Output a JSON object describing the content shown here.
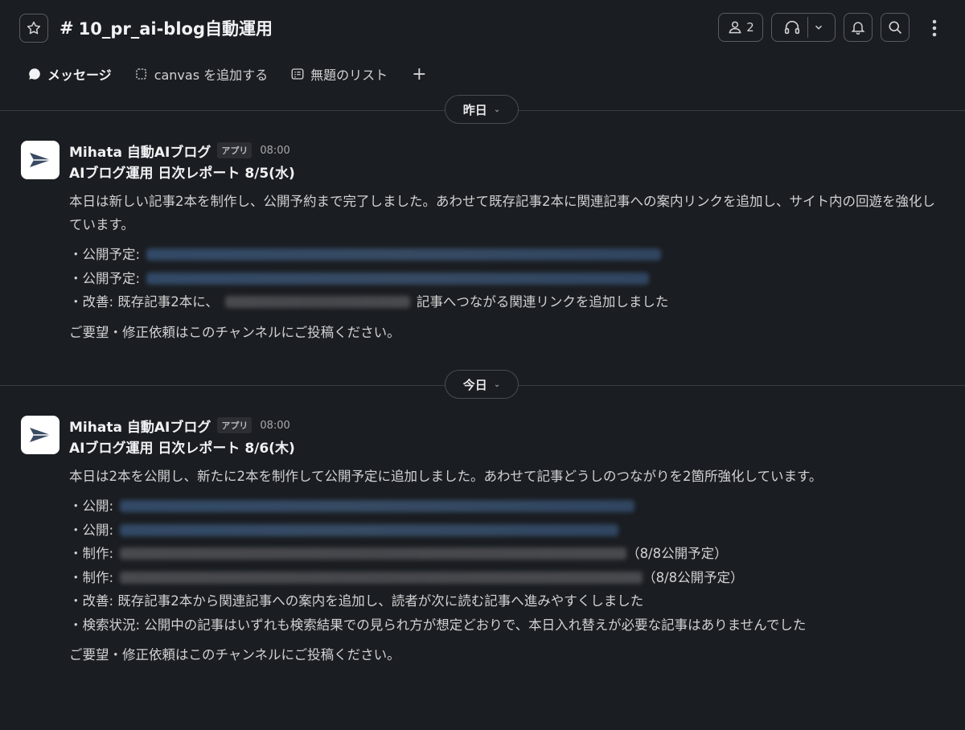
{
  "header": {
    "channel_hash": "#",
    "channel_name": "10_pr_ai-blog自動運用",
    "member_count": "2"
  },
  "tabs": [
    {
      "label": "メッセージ",
      "active": true
    },
    {
      "label": "canvas を追加する"
    },
    {
      "label": "無題のリスト"
    }
  ],
  "dividers": {
    "yesterday": "昨日",
    "today": "今日"
  },
  "messages": [
    {
      "sender": "Mihata 自動AIブログ",
      "badge": "アプリ",
      "time": "08:00",
      "title": "AIブログ運用 日次レポート 8/5(水)",
      "body": "本日は新しい記事2本を制作し、公開予約まで完了しました。あわせて既存記事2本に関連記事への案内リンクを追加し、サイト内の回遊を強化しています。",
      "items": [
        {
          "label": "・公開予定:"
        },
        {
          "label": "・公開予定:"
        },
        {
          "label": "・改善: 既存記事2本に、",
          "after": "記事へつながる関連リンクを追加しました"
        }
      ],
      "closing": "ご要望・修正依頼はこのチャンネルにご投稿ください。"
    },
    {
      "sender": "Mihata 自動AIブログ",
      "badge": "アプリ",
      "time": "08:00",
      "title": "AIブログ運用 日次レポート 8/6(木)",
      "body": "本日は2本を公開し、新たに2本を制作して公開予定に追加しました。あわせて記事どうしのつながりを2箇所強化しています。",
      "items": [
        {
          "label": "・公開:"
        },
        {
          "label": "・公開:"
        },
        {
          "label": "・制作:",
          "after": "（8/8公開予定）"
        },
        {
          "label": "・制作:",
          "after": "（8/8公開予定）"
        },
        {
          "label": "・改善: 既存記事2本から関連記事への案内を追加し、読者が次に読む記事へ進みやすくしました"
        },
        {
          "label": "・検索状況: 公開中の記事はいずれも検索結果での見られ方が想定どおりで、本日入れ替えが必要な記事はありませんでした"
        }
      ],
      "closing": "ご要望・修正依頼はこのチャンネルにご投稿ください。"
    }
  ]
}
